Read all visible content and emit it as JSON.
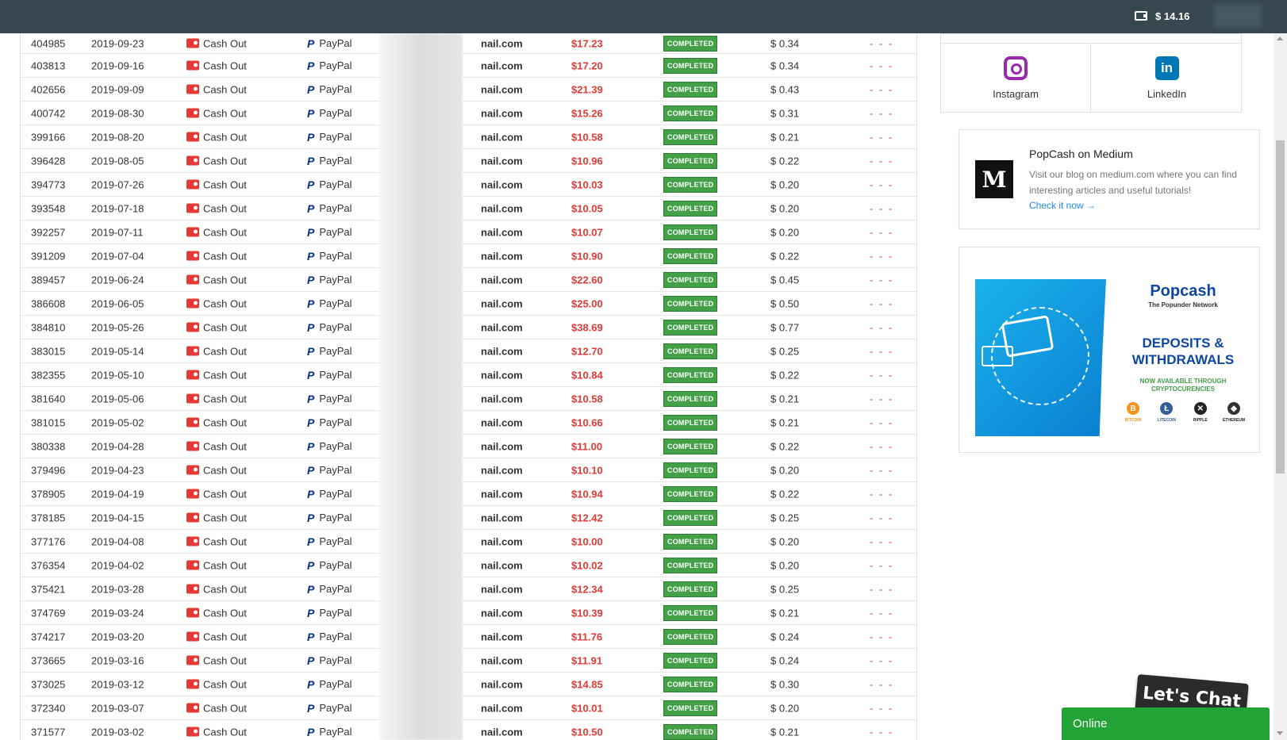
{
  "topbar": {
    "balance": "$ 14.16"
  },
  "table": {
    "rows": [
      {
        "id": "404985",
        "date": "2019-09-23",
        "type": "Cash Out",
        "method": "PayPal",
        "email": "nail.com",
        "amount": "$17.23",
        "status": "COMPLETED",
        "fee": "$ 0.34",
        "note": "- - -"
      },
      {
        "id": "403813",
        "date": "2019-09-16",
        "type": "Cash Out",
        "method": "PayPal",
        "email": "nail.com",
        "amount": "$17.20",
        "status": "COMPLETED",
        "fee": "$ 0.34",
        "note": "- - -"
      },
      {
        "id": "402656",
        "date": "2019-09-09",
        "type": "Cash Out",
        "method": "PayPal",
        "email": "nail.com",
        "amount": "$21.39",
        "status": "COMPLETED",
        "fee": "$ 0.43",
        "note": "- - -"
      },
      {
        "id": "400742",
        "date": "2019-08-30",
        "type": "Cash Out",
        "method": "PayPal",
        "email": "nail.com",
        "amount": "$15.26",
        "status": "COMPLETED",
        "fee": "$ 0.31",
        "note": "- - -"
      },
      {
        "id": "399166",
        "date": "2019-08-20",
        "type": "Cash Out",
        "method": "PayPal",
        "email": "nail.com",
        "amount": "$10.58",
        "status": "COMPLETED",
        "fee": "$ 0.21",
        "note": "- - -"
      },
      {
        "id": "396428",
        "date": "2019-08-05",
        "type": "Cash Out",
        "method": "PayPal",
        "email": "nail.com",
        "amount": "$10.96",
        "status": "COMPLETED",
        "fee": "$ 0.22",
        "note": "- - -"
      },
      {
        "id": "394773",
        "date": "2019-07-26",
        "type": "Cash Out",
        "method": "PayPal",
        "email": "nail.com",
        "amount": "$10.03",
        "status": "COMPLETED",
        "fee": "$ 0.20",
        "note": "- - -"
      },
      {
        "id": "393548",
        "date": "2019-07-18",
        "type": "Cash Out",
        "method": "PayPal",
        "email": "nail.com",
        "amount": "$10.05",
        "status": "COMPLETED",
        "fee": "$ 0.20",
        "note": "- - -"
      },
      {
        "id": "392257",
        "date": "2019-07-11",
        "type": "Cash Out",
        "method": "PayPal",
        "email": "nail.com",
        "amount": "$10.07",
        "status": "COMPLETED",
        "fee": "$ 0.20",
        "note": "- - -"
      },
      {
        "id": "391209",
        "date": "2019-07-04",
        "type": "Cash Out",
        "method": "PayPal",
        "email": "nail.com",
        "amount": "$10.90",
        "status": "COMPLETED",
        "fee": "$ 0.22",
        "note": "- - -"
      },
      {
        "id": "389457",
        "date": "2019-06-24",
        "type": "Cash Out",
        "method": "PayPal",
        "email": "nail.com",
        "amount": "$22.60",
        "status": "COMPLETED",
        "fee": "$ 0.45",
        "note": "- - -"
      },
      {
        "id": "386608",
        "date": "2019-06-05",
        "type": "Cash Out",
        "method": "PayPal",
        "email": "nail.com",
        "amount": "$25.00",
        "status": "COMPLETED",
        "fee": "$ 0.50",
        "note": "- - -"
      },
      {
        "id": "384810",
        "date": "2019-05-26",
        "type": "Cash Out",
        "method": "PayPal",
        "email": "nail.com",
        "amount": "$38.69",
        "status": "COMPLETED",
        "fee": "$ 0.77",
        "note": "- - -"
      },
      {
        "id": "383015",
        "date": "2019-05-14",
        "type": "Cash Out",
        "method": "PayPal",
        "email": "nail.com",
        "amount": "$12.70",
        "status": "COMPLETED",
        "fee": "$ 0.25",
        "note": "- - -"
      },
      {
        "id": "382355",
        "date": "2019-05-10",
        "type": "Cash Out",
        "method": "PayPal",
        "email": "nail.com",
        "amount": "$10.84",
        "status": "COMPLETED",
        "fee": "$ 0.22",
        "note": "- - -"
      },
      {
        "id": "381640",
        "date": "2019-05-06",
        "type": "Cash Out",
        "method": "PayPal",
        "email": "nail.com",
        "amount": "$10.58",
        "status": "COMPLETED",
        "fee": "$ 0.21",
        "note": "- - -"
      },
      {
        "id": "381015",
        "date": "2019-05-02",
        "type": "Cash Out",
        "method": "PayPal",
        "email": "nail.com",
        "amount": "$10.66",
        "status": "COMPLETED",
        "fee": "$ 0.21",
        "note": "- - -"
      },
      {
        "id": "380338",
        "date": "2019-04-28",
        "type": "Cash Out",
        "method": "PayPal",
        "email": "nail.com",
        "amount": "$11.00",
        "status": "COMPLETED",
        "fee": "$ 0.22",
        "note": "- - -"
      },
      {
        "id": "379496",
        "date": "2019-04-23",
        "type": "Cash Out",
        "method": "PayPal",
        "email": "nail.com",
        "amount": "$10.10",
        "status": "COMPLETED",
        "fee": "$ 0.20",
        "note": "- - -"
      },
      {
        "id": "378905",
        "date": "2019-04-19",
        "type": "Cash Out",
        "method": "PayPal",
        "email": "nail.com",
        "amount": "$10.94",
        "status": "COMPLETED",
        "fee": "$ 0.22",
        "note": "- - -"
      },
      {
        "id": "378185",
        "date": "2019-04-15",
        "type": "Cash Out",
        "method": "PayPal",
        "email": "nail.com",
        "amount": "$12.42",
        "status": "COMPLETED",
        "fee": "$ 0.25",
        "note": "- - -"
      },
      {
        "id": "377176",
        "date": "2019-04-08",
        "type": "Cash Out",
        "method": "PayPal",
        "email": "nail.com",
        "amount": "$10.00",
        "status": "COMPLETED",
        "fee": "$ 0.20",
        "note": "- - -"
      },
      {
        "id": "376354",
        "date": "2019-04-02",
        "type": "Cash Out",
        "method": "PayPal",
        "email": "nail.com",
        "amount": "$10.02",
        "status": "COMPLETED",
        "fee": "$ 0.20",
        "note": "- - -"
      },
      {
        "id": "375421",
        "date": "2019-03-28",
        "type": "Cash Out",
        "method": "PayPal",
        "email": "nail.com",
        "amount": "$12.34",
        "status": "COMPLETED",
        "fee": "$ 0.25",
        "note": "- - -"
      },
      {
        "id": "374769",
        "date": "2019-03-24",
        "type": "Cash Out",
        "method": "PayPal",
        "email": "nail.com",
        "amount": "$10.39",
        "status": "COMPLETED",
        "fee": "$ 0.21",
        "note": "- - -"
      },
      {
        "id": "374217",
        "date": "2019-03-20",
        "type": "Cash Out",
        "method": "PayPal",
        "email": "nail.com",
        "amount": "$11.76",
        "status": "COMPLETED",
        "fee": "$ 0.24",
        "note": "- - -"
      },
      {
        "id": "373665",
        "date": "2019-03-16",
        "type": "Cash Out",
        "method": "PayPal",
        "email": "nail.com",
        "amount": "$11.91",
        "status": "COMPLETED",
        "fee": "$ 0.24",
        "note": "- - -"
      },
      {
        "id": "373025",
        "date": "2019-03-12",
        "type": "Cash Out",
        "method": "PayPal",
        "email": "nail.com",
        "amount": "$14.85",
        "status": "COMPLETED",
        "fee": "$ 0.30",
        "note": "- - -"
      },
      {
        "id": "372340",
        "date": "2019-03-07",
        "type": "Cash Out",
        "method": "PayPal",
        "email": "nail.com",
        "amount": "$10.01",
        "status": "COMPLETED",
        "fee": "$ 0.20",
        "note": "- - -"
      },
      {
        "id": "371577",
        "date": "2019-03-02",
        "type": "Cash Out",
        "method": "PayPal",
        "email": "nail.com",
        "amount": "$10.50",
        "status": "COMPLETED",
        "fee": "$ 0.21",
        "note": "- - -"
      }
    ]
  },
  "social": {
    "instagram": "Instagram",
    "linkedin": "LinkedIn"
  },
  "medium": {
    "logo": "M",
    "title": "PopCash on Medium",
    "description": "Visit our blog on medium.com where you can find interesting articles and useful tutorials!",
    "link": "Check it now →"
  },
  "promo": {
    "brand": "Popcash",
    "subtitle": "The Popunder Network",
    "headline": "DEPOSITS & WITHDRAWALS",
    "available": "NOW AVAILABLE THROUGH CRYPTOCURENCIES",
    "coins": [
      {
        "name": "BITCOIN",
        "symbol": "B",
        "color": "#f7931a"
      },
      {
        "name": "LITECOIN",
        "symbol": "Ł",
        "color": "#345d9d"
      },
      {
        "name": "RIPPLE",
        "symbol": "✕",
        "color": "#222222"
      },
      {
        "name": "ETHEREUM",
        "symbol": "◆",
        "color": "#333333"
      }
    ]
  },
  "chat": {
    "badge": "Let's Chat",
    "status": "Online"
  }
}
